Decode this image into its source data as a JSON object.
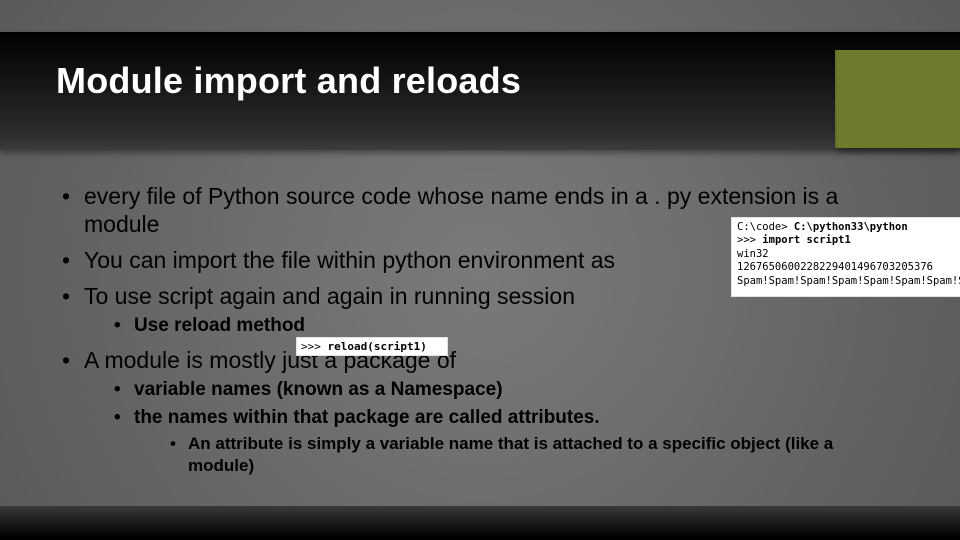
{
  "title": "Module import and reloads",
  "bullets": {
    "b0": "every file of Python source code whose name ends in a  . py extension is a module",
    "b1": "You can import the file within python environment as",
    "b2": "To use script again and again in running session",
    "b2_s0": "Use reload method",
    "b3": "A module is mostly just a package of",
    "b3_s0": "variable names (known as a Namespace)",
    "b3_s1": "the names within that package are called  attributes.",
    "b3_s1_s0": "An  attribute is simply a variable name that is attached to a specific object (like a module)"
  },
  "console": {
    "l1_a": "C:\\code> ",
    "l1_b": "C:\\python33\\python",
    "l2_a": ">>> ",
    "l2_b": "import script1",
    "l3": "win32",
    "l4": "1267650600228229401496703205376",
    "l5": "Spam!Spam!Spam!Spam!Spam!Spam!Spam!Spam!"
  },
  "reload_snip": {
    "a": ">>> ",
    "b": "reload(script1)"
  }
}
